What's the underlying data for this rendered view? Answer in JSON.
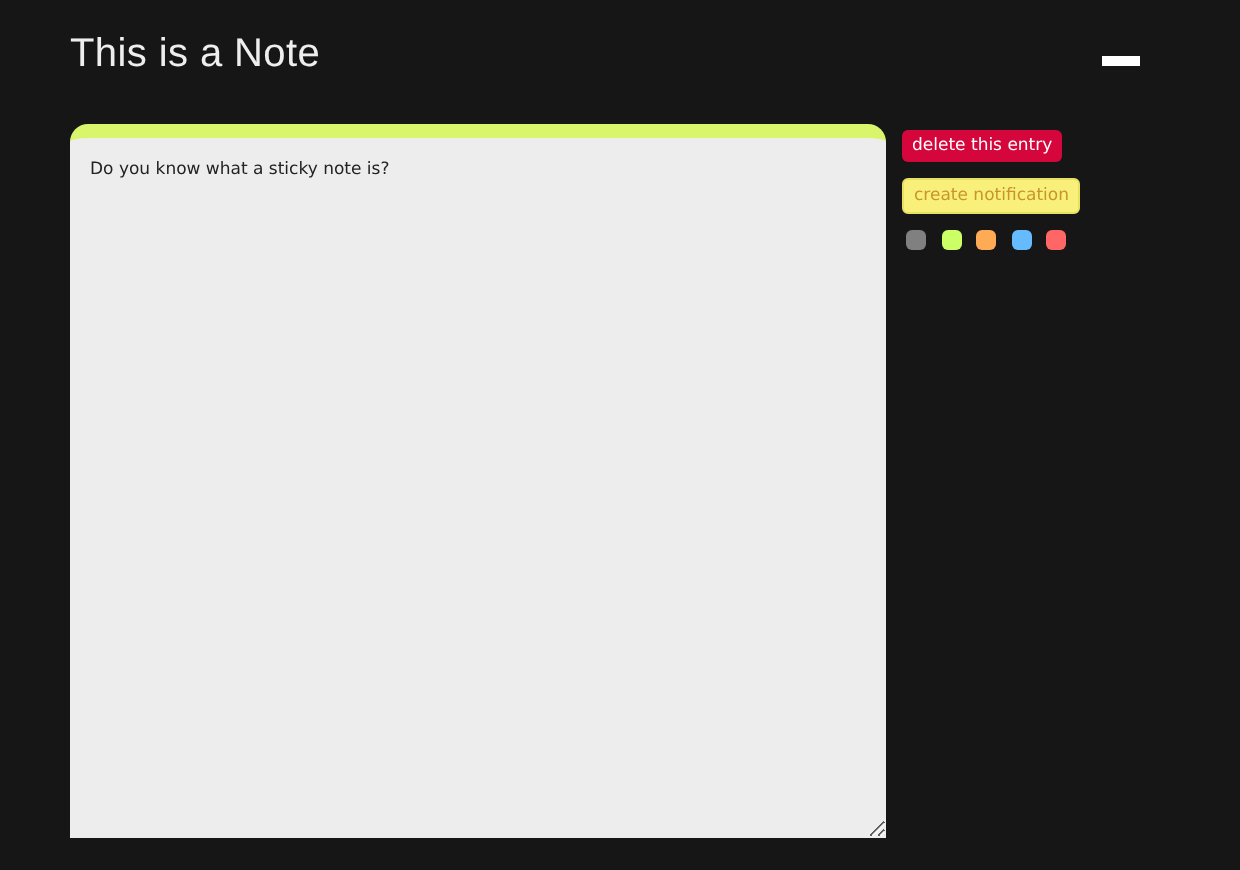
{
  "title": "This is a Note",
  "note": {
    "text": "Do you know what a sticky note is?",
    "color": "#d9f56b"
  },
  "actions": [
    {
      "label": "delete this entry",
      "kind": "danger"
    },
    {
      "label": "create notification",
      "kind": "warning"
    }
  ],
  "swatches": [
    {
      "color": "#808080"
    },
    {
      "color": "#ccff66"
    },
    {
      "color": "#ffaa55"
    },
    {
      "color": "#66bbff"
    },
    {
      "color": "#ff6666"
    }
  ]
}
